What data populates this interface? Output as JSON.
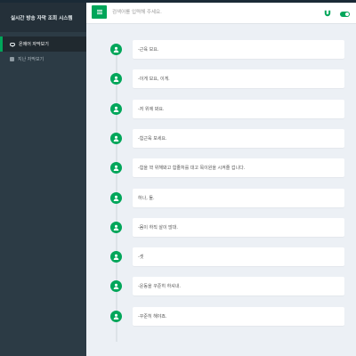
{
  "app": {
    "title": "실시간 방송 자막 조회 시스템"
  },
  "sidebar": {
    "items": [
      {
        "label": "온에어 자막보기",
        "icon": "chat-icon",
        "active": true
      },
      {
        "label": "지난 자막보기",
        "icon": "list-icon",
        "active": false
      }
    ]
  },
  "header": {
    "menu_icon": "hamburger-icon",
    "search_placeholder": "검색어를 입력해 주세요.",
    "magnet_icon": "magnet-icon",
    "toggle_state": "on"
  },
  "colors": {
    "accent": "#00a65a",
    "sidebar_bg": "#2c3b45",
    "brand_bg": "#243039",
    "page_bg": "#ecf0f5"
  },
  "captions": [
    {
      "text": "-근육 보요."
    },
    {
      "text": "-이게 보요, 이게."
    },
    {
      "text": "-저 위에 봐요."
    },
    {
      "text": "-힘근육 보세요."
    },
    {
      "text": "-힘을 꽉 위해봐고 힘줄처를 대고 목이원을 시켜줄 겁니다."
    },
    {
      "text": "하나, 둘."
    },
    {
      "text": "-몸이 하직 살이 많대."
    },
    {
      "text": "-셋"
    },
    {
      "text": "-운동을 꾸준히 하셔내."
    },
    {
      "text": "-꾸준히 해야죠."
    }
  ]
}
